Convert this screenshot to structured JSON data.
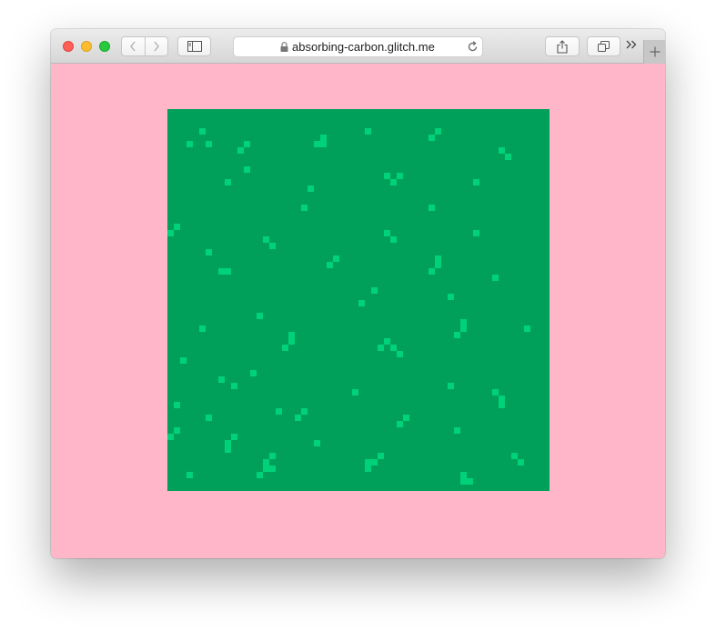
{
  "browser": {
    "url": "absorbing-carbon.glitch.me",
    "icons": {
      "back": "chevron-left-icon",
      "forward": "chevron-right-icon",
      "sidebar": "sidebar-icon",
      "lock": "lock-icon",
      "reload": "reload-icon",
      "share": "share-icon",
      "tabs": "tabs-icon",
      "more": "double-chevron-icon",
      "new_tab": "plus-icon"
    }
  },
  "page": {
    "background_color": "#ffb6c8",
    "grid": {
      "size": 60,
      "background_color": "#00a05a",
      "cell_color": "#00d27a",
      "live_cells": [
        [
          5,
          3
        ],
        [
          3,
          5
        ],
        [
          6,
          5
        ],
        [
          24,
          4
        ],
        [
          23,
          5
        ],
        [
          24,
          5
        ],
        [
          31,
          3
        ],
        [
          42,
          3
        ],
        [
          41,
          4
        ],
        [
          12,
          5
        ],
        [
          11,
          6
        ],
        [
          52,
          6
        ],
        [
          53,
          7
        ],
        [
          12,
          9
        ],
        [
          9,
          11
        ],
        [
          34,
          10
        ],
        [
          36,
          10
        ],
        [
          35,
          11
        ],
        [
          48,
          11
        ],
        [
          22,
          12
        ],
        [
          21,
          15
        ],
        [
          41,
          15
        ],
        [
          1,
          18
        ],
        [
          0,
          19
        ],
        [
          48,
          19
        ],
        [
          34,
          19
        ],
        [
          35,
          20
        ],
        [
          15,
          20
        ],
        [
          16,
          21
        ],
        [
          6,
          22
        ],
        [
          26,
          23
        ],
        [
          25,
          24
        ],
        [
          42,
          23
        ],
        [
          42,
          24
        ],
        [
          41,
          25
        ],
        [
          8,
          25
        ],
        [
          9,
          25
        ],
        [
          51,
          26
        ],
        [
          32,
          28
        ],
        [
          30,
          30
        ],
        [
          44,
          29
        ],
        [
          14,
          32
        ],
        [
          46,
          33
        ],
        [
          46,
          34
        ],
        [
          45,
          35
        ],
        [
          5,
          34
        ],
        [
          56,
          34
        ],
        [
          19,
          35
        ],
        [
          19,
          36
        ],
        [
          18,
          37
        ],
        [
          34,
          36
        ],
        [
          33,
          37
        ],
        [
          35,
          37
        ],
        [
          36,
          38
        ],
        [
          2,
          39
        ],
        [
          13,
          41
        ],
        [
          8,
          42
        ],
        [
          10,
          43
        ],
        [
          44,
          43
        ],
        [
          29,
          44
        ],
        [
          51,
          44
        ],
        [
          52,
          45
        ],
        [
          52,
          46
        ],
        [
          1,
          46
        ],
        [
          21,
          47
        ],
        [
          17,
          47
        ],
        [
          20,
          48
        ],
        [
          6,
          48
        ],
        [
          37,
          48
        ],
        [
          36,
          49
        ],
        [
          45,
          50
        ],
        [
          1,
          50
        ],
        [
          0,
          51
        ],
        [
          10,
          51
        ],
        [
          9,
          52
        ],
        [
          9,
          53
        ],
        [
          23,
          52
        ],
        [
          33,
          54
        ],
        [
          32,
          55
        ],
        [
          31,
          55
        ],
        [
          31,
          56
        ],
        [
          16,
          54
        ],
        [
          15,
          55
        ],
        [
          15,
          56
        ],
        [
          14,
          57
        ],
        [
          54,
          54
        ],
        [
          55,
          55
        ],
        [
          16,
          56
        ],
        [
          3,
          57
        ],
        [
          46,
          57
        ],
        [
          46,
          58
        ],
        [
          47,
          58
        ]
      ]
    }
  }
}
